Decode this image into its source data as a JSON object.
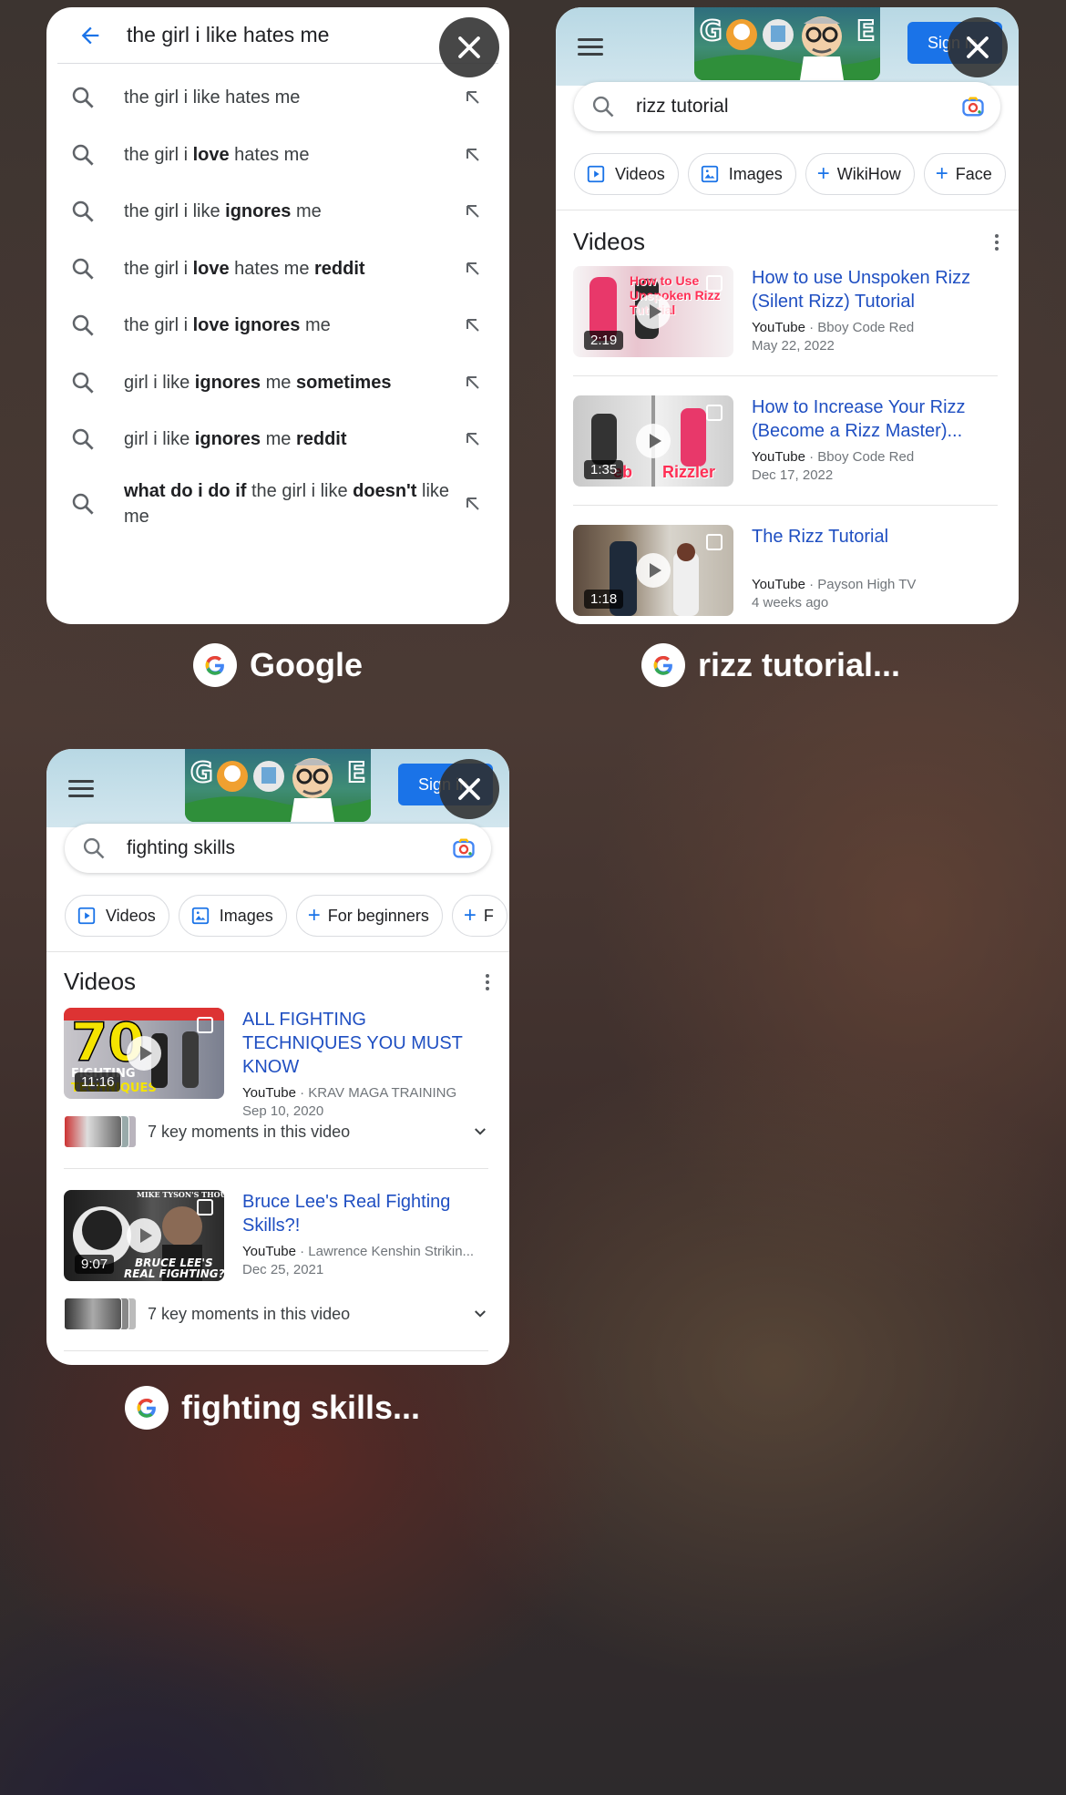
{
  "tabs": [
    {
      "label": "Google",
      "search": {
        "query": "the girl i like hates me",
        "suggestions": [
          {
            "segments": [
              {
                "t": "the girl i like hates me",
                "b": false
              }
            ]
          },
          {
            "segments": [
              {
                "t": "the girl i ",
                "b": false
              },
              {
                "t": "love",
                "b": true
              },
              {
                "t": " hates me",
                "b": false
              }
            ]
          },
          {
            "segments": [
              {
                "t": "the girl i like ",
                "b": false
              },
              {
                "t": "ignores",
                "b": true
              },
              {
                "t": " me",
                "b": false
              }
            ]
          },
          {
            "segments": [
              {
                "t": "the girl i ",
                "b": false
              },
              {
                "t": "love",
                "b": true
              },
              {
                "t": " hates me ",
                "b": false
              },
              {
                "t": "reddit",
                "b": true
              }
            ]
          },
          {
            "segments": [
              {
                "t": "the girl i ",
                "b": false
              },
              {
                "t": "love",
                "b": true
              },
              {
                "t": " ",
                "b": false
              },
              {
                "t": "ignores",
                "b": true
              },
              {
                "t": " me",
                "b": false
              }
            ]
          },
          {
            "segments": [
              {
                "t": "girl i like ",
                "b": false
              },
              {
                "t": "ignores",
                "b": true
              },
              {
                "t": " me ",
                "b": false
              },
              {
                "t": "sometimes",
                "b": true
              }
            ]
          },
          {
            "segments": [
              {
                "t": "girl i like ",
                "b": false
              },
              {
                "t": "ignores",
                "b": true
              },
              {
                "t": " me ",
                "b": false
              },
              {
                "t": "reddit",
                "b": true
              }
            ]
          },
          {
            "segments": [
              {
                "t": "what do i do if",
                "b": true
              },
              {
                "t": " the girl i like ",
                "b": false
              },
              {
                "t": "doesn't",
                "b": true
              },
              {
                "t": " like me",
                "b": false
              }
            ],
            "two_line": true
          }
        ]
      }
    },
    {
      "label": "rizz tutorial...",
      "header": {
        "signin": "Sign in"
      },
      "search": {
        "query": "rizz tutorial"
      },
      "chips": [
        {
          "label": "Videos",
          "icon": "video-icon"
        },
        {
          "label": "Images",
          "icon": "image-icon"
        },
        {
          "label": "WikiHow",
          "icon": "plus-icon"
        },
        {
          "label": "Face",
          "icon": "plus-icon"
        }
      ],
      "videos_heading": "Videos",
      "videos": [
        {
          "title": "How to use Unspoken Rizz (Silent Rizz) Tutorial",
          "platform": "YouTube",
          "channel": "Bboy Code Red",
          "date": "May 22, 2022",
          "duration": "2:19",
          "overlay": "How to Use Unspoken Rizz Tutorial"
        },
        {
          "title": "How to Increase Your Rizz (Become a Rizz Master)...",
          "platform": "YouTube",
          "channel": "Bboy Code Red",
          "date": "Dec 17, 2022",
          "duration": "1:35",
          "overlay": "Rizzler"
        },
        {
          "title": "The Rizz Tutorial",
          "platform": "YouTube",
          "channel": "Payson High TV",
          "date": "4 weeks ago",
          "duration": "1:18"
        }
      ]
    },
    {
      "label": "fighting skills...",
      "header": {
        "signin": "Sign in"
      },
      "search": {
        "query": "fighting skills"
      },
      "chips": [
        {
          "label": "Videos",
          "icon": "video-icon"
        },
        {
          "label": "Images",
          "icon": "image-icon"
        },
        {
          "label": "For beginners",
          "icon": "plus-icon"
        },
        {
          "label": "F",
          "icon": "plus-icon"
        }
      ],
      "videos_heading": "Videos",
      "videos": [
        {
          "title": "ALL FIGHTING TECHNIQUES YOU MUST KNOW",
          "platform": "YouTube",
          "channel": "KRAV MAGA TRAINING",
          "date": "Sep 10, 2020",
          "duration": "11:16",
          "overlay": "70 FIGHTING TECHNIQUES",
          "key_moments": "7 key moments in this video"
        },
        {
          "title": "Bruce Lee's Real Fighting Skills?!",
          "platform": "YouTube",
          "channel": "Lawrence Kenshin Strikin...",
          "date": "Dec 25, 2021",
          "duration": "9:07",
          "overlay": "BRUCE LEE'S REAL FIGHTING?",
          "key_moments": "7 key moments in this video"
        }
      ]
    }
  ],
  "colors": {
    "link": "#1f4fc2",
    "signin": "#1a73e8",
    "accent": "#1a73e8"
  }
}
